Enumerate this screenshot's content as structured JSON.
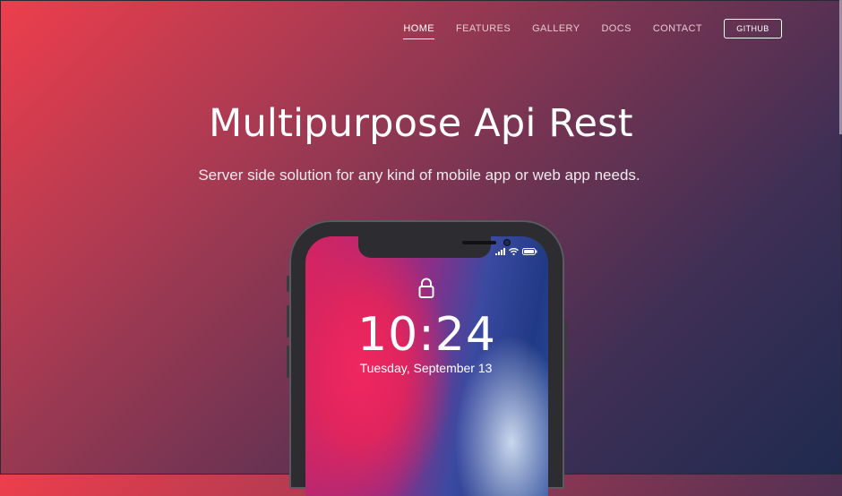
{
  "nav": {
    "items": [
      {
        "label": "HOME",
        "active": true
      },
      {
        "label": "FEATURES",
        "active": false
      },
      {
        "label": "GALLERY",
        "active": false
      },
      {
        "label": "DOCS",
        "active": false
      },
      {
        "label": "CONTACT",
        "active": false
      }
    ],
    "github_label": "GITHUB"
  },
  "hero": {
    "title": "Multipurpose Api Rest",
    "subtitle": "Server side solution for any kind of mobile app or web app needs."
  },
  "phone": {
    "time": "10:24",
    "date": "Tuesday, September 13",
    "icons": [
      "signal-icon",
      "wifi-icon",
      "battery-icon",
      "lock-icon"
    ]
  },
  "colors": {
    "gradient_start": "#ee3e4c",
    "gradient_end": "#1f2a4f",
    "text": "#ffffff"
  }
}
